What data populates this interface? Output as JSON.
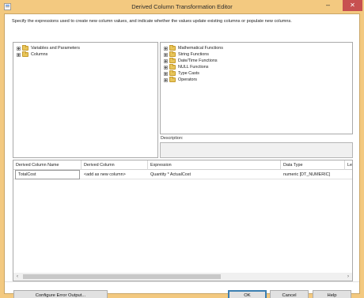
{
  "window": {
    "title": "Derived Column Transformation Editor",
    "controls": {
      "minimize": "–",
      "maximize": "□",
      "close": "✕"
    },
    "icon": "app-icon",
    "accent": "#f3c980",
    "close_color": "#c75050"
  },
  "instruction": "Specify the expressions used to create new column values, and indicate whether the values update existing columns or populate new columns.",
  "left_tree": [
    {
      "label": "Variables and Parameters",
      "icon": "folder-icon"
    },
    {
      "label": "Columns",
      "icon": "folder-icon"
    }
  ],
  "right_tree": [
    {
      "label": "Mathematical Functions",
      "icon": "folder-icon"
    },
    {
      "label": "String Functions",
      "icon": "folder-icon"
    },
    {
      "label": "Date/Time Functions",
      "icon": "folder-icon"
    },
    {
      "label": "NULL Functions",
      "icon": "folder-icon"
    },
    {
      "label": "Type Casts",
      "icon": "folder-icon"
    },
    {
      "label": "Operators",
      "icon": "folder-icon"
    }
  ],
  "description_label": "Description:",
  "grid": {
    "headers": [
      "Derived Column Name",
      "Derived Column",
      "Expression",
      "Data Type",
      "Le"
    ],
    "rows": [
      [
        "TotalCost",
        "<add as new column>",
        "Quantity * ActualCost",
        "numeric [DT_NUMERIC]",
        ""
      ]
    ]
  },
  "buttons": {
    "configure_error_output": "Configure Error Output...",
    "ok": "OK",
    "cancel": "Cancel",
    "help": "Help"
  }
}
